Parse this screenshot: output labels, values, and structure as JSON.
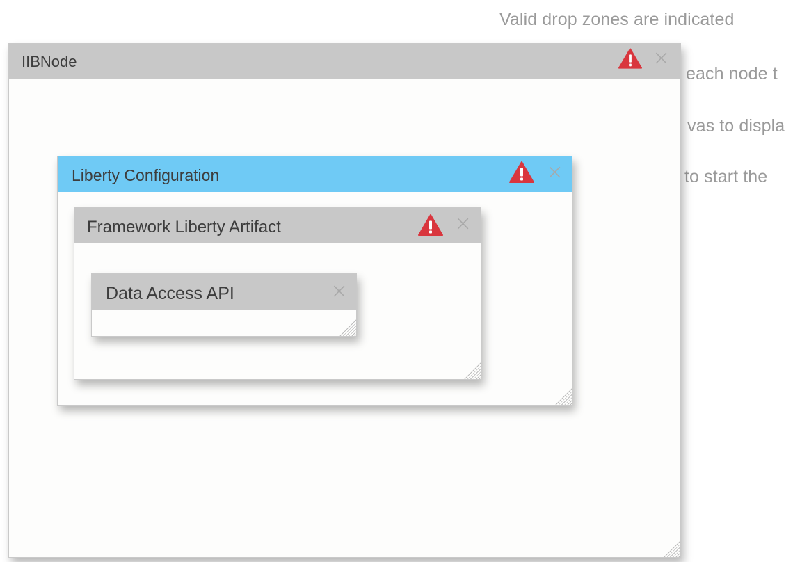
{
  "background_instructions": [
    "Valid drop zones are indicated",
    "each node t",
    "vas to displa",
    "to start the"
  ],
  "nodes": {
    "iib": {
      "title": "IIBNode",
      "has_warning": true
    },
    "liberty": {
      "title": "Liberty Configuration",
      "has_warning": true
    },
    "framework": {
      "title": "Framework Liberty Artifact",
      "has_warning": true
    },
    "data_access": {
      "title": "Data Access API",
      "has_warning": false
    }
  },
  "icons": {
    "close": "×",
    "warning": "warning-triangle-icon",
    "resize": "resize-grip-icon"
  },
  "colors": {
    "header_gray": "#c8c8c8",
    "header_blue": "#6fcaf5",
    "warning_red": "#d9363e",
    "background_text": "#9a9a9a"
  }
}
